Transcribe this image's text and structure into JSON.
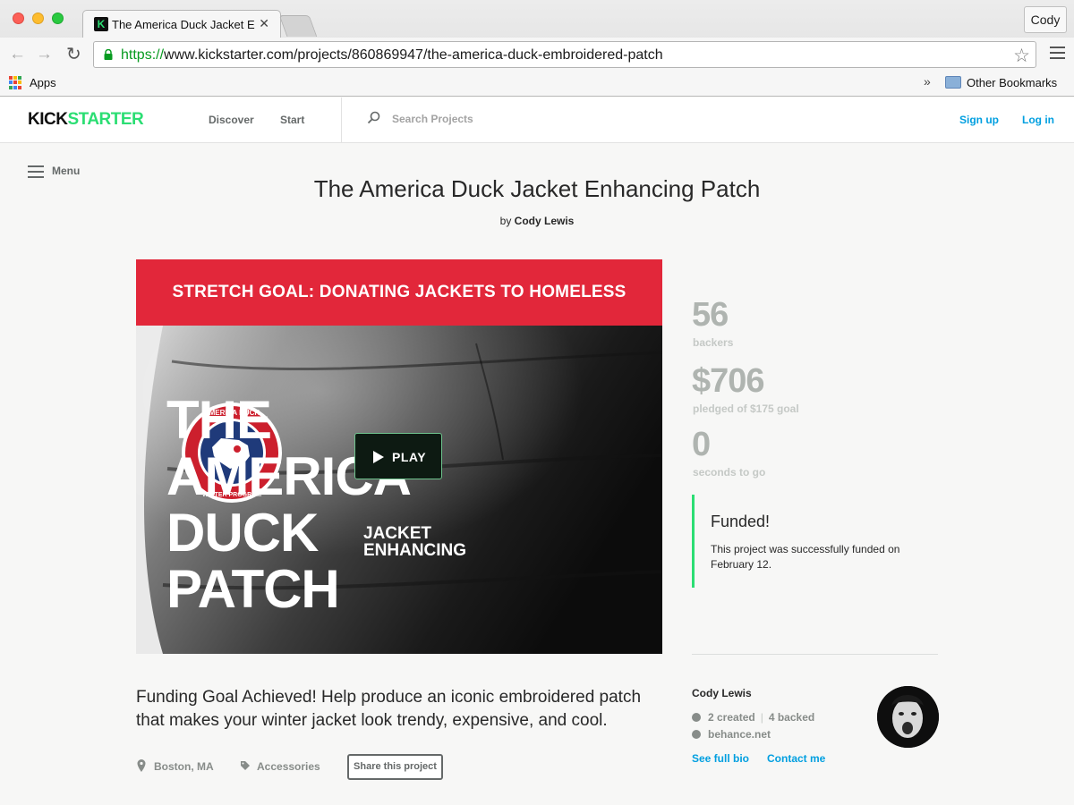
{
  "browser": {
    "tab_title": "The America Duck Jacket Enhancing Patch",
    "tab_close": "✕",
    "profile": "Cody",
    "url_scheme": "https://",
    "url_rest": "www.kickstarter.com/projects/860869947/the-america-duck-embroidered-patch",
    "bookmarks": {
      "apps": "Apps",
      "overflow": "»",
      "other": "Other Bookmarks"
    }
  },
  "header": {
    "logo_kick": "KICK",
    "logo_starter": "STARTER",
    "nav": {
      "discover": "Discover",
      "start": "Start"
    },
    "search_placeholder": "Search Projects",
    "signup": "Sign up",
    "login": "Log in"
  },
  "menu_label": "Menu",
  "project": {
    "title": "The America Duck Jacket Enhancing Patch",
    "by": "by",
    "creator": "Cody Lewis",
    "blurb": "Funding Goal Achieved! Help produce an iconic embroidered patch that makes your winter jacket look trendy, expensive, and cool.",
    "location": "Boston, MA",
    "category": "Accessories",
    "share_label": "Share this project"
  },
  "video": {
    "banner": "STRETCH GOAL: DONATING JACKETS TO HOMELESS",
    "patch_title": [
      "THE",
      "AMERICA",
      "DUCK",
      "PATCH"
    ],
    "patch_subtitle": [
      "JACKET",
      "ENHANCING"
    ],
    "patch_ring_top": "AMERICA DUCK",
    "patch_ring_bottom": "WINTER PROGRAM",
    "play_label": "PLAY"
  },
  "stats": {
    "backers_value": "56",
    "backers_label": "backers",
    "pledged_value": "$706",
    "pledged_label": "pledged of $175 goal",
    "time_value": "0",
    "time_label": "seconds to go"
  },
  "funded": {
    "title": "Funded!",
    "text": "This project was successfully funded on February 12."
  },
  "creator_box": {
    "name": "Cody Lewis",
    "created": "2 created",
    "separator": "|",
    "backed": "4 backed",
    "website": "behance.net",
    "full_bio": "See full bio",
    "contact": "Contact me"
  },
  "colors": {
    "brand_green": "#2bde73",
    "link_blue": "#009fe0",
    "banner_red": "#e2273a",
    "stat_gray": "#afb4b0"
  }
}
